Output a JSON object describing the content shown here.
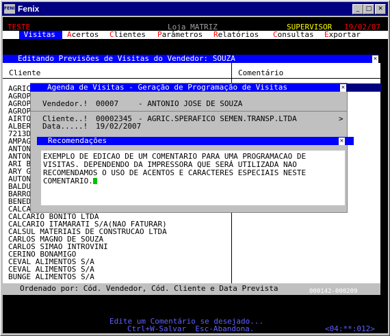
{
  "window": {
    "title": "Fenix",
    "icon_text": "FENIX"
  },
  "header": {
    "left": "TESTE",
    "center": "Loja MATRIZ",
    "user": "SUPERVISOR",
    "date": "19/02/07"
  },
  "menu": [
    {
      "hot": "V",
      "rest": "isitas"
    },
    {
      "hot": "A",
      "rest": "certos"
    },
    {
      "hot": "C",
      "rest": "lientes"
    },
    {
      "hot": "P",
      "rest": "arâmetros"
    },
    {
      "hot": "R",
      "rest": "elatórios"
    },
    {
      "hot": "C",
      "rest": "onsultas"
    },
    {
      "hot": "E",
      "rest": "xportar"
    }
  ],
  "edit_panel": {
    "title": "Editando Previsões de Visitas do Vendedor: SOUZA",
    "col_cliente": "Cliente",
    "col_comentario": "Comentário",
    "scroll_arrows": "<>",
    "clients": [
      "AGRIC",
      "AGROP",
      "AGROP",
      "AGROP",
      "AIRTO",
      "ALBER",
      "7213D",
      "AMPAG",
      "ANTON",
      "ANTON",
      "ARI B",
      "ARY G",
      "AUTON",
      "BALDU",
      "BARRO",
      "BENED",
      "CALCA",
      "CALCARIO BONITO LTDA",
      "CALCARIO ITAMARATI S/A(NAO FATURAR)",
      "CALSUL MATERIAIS DE CONSTRUCAO LTDA",
      "CARLOS MAGNO DE SOUZA",
      "CARLOS SIMAO INTROVINI",
      "CERINO BONAMIGO",
      "CEVAL ALIMENTOS S/A",
      "CEVAL ALIMENTOS S/A",
      "BUNGE ALIMENTOS S/A"
    ],
    "footer": "Ordenado por: Cód. Vendedor, Cód. Cliente e Data Prevista",
    "record_info": "000142-000209"
  },
  "agenda": {
    "title": "Agenda de Visitas - Geração de Programação de Visitas",
    "vendedor_label": "Vendedor.!",
    "vendedor_code": "00007",
    "vendedor_name": "- ANTONIO JOSE DE SOUZA",
    "cliente_label": "Cliente..!",
    "cliente_code": "00002345",
    "cliente_name": "- AGRIC.SPERAFICO SEMEN.TRANSP.LTDA",
    "cliente_arrow": ">",
    "data_label": "Data.....!",
    "data_value": "19/02/2007"
  },
  "recomendacoes": {
    "title": "Recomendações",
    "text_lines": [
      "EXEMPLO DE EDICAO DE UM COMENTARIO PARA UMA PROGRAMACAO DE",
      "VISITAS. DEPENDENDO DA IMPRESSORA QUE SERÁ UTILIZADA NAO",
      "RECOMENDAMOS O USO DE ACENTOS E CARACTERES ESPECIAIS NESTE",
      "COMENTARIO."
    ]
  },
  "status": {
    "line1": "Edite um Comentário se desejado...",
    "line2": "Ctrl+W-Salvar  Esc-Abandona.",
    "position": "<04:**:012>"
  },
  "colors": {
    "title_bar": "#000080",
    "panel_blue": "#0000ff",
    "header_red": "#ff0000",
    "cursor": "#00c000"
  }
}
